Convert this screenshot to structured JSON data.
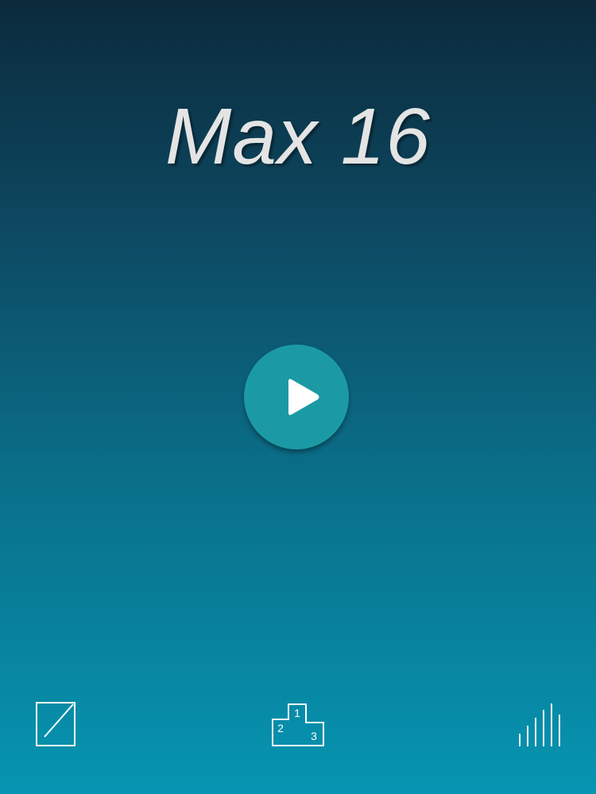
{
  "title": "Max 16",
  "play_button": {
    "icon": "play-icon"
  },
  "bottom_bar": {
    "edit": {
      "icon": "edit-icon"
    },
    "leaderboard": {
      "icon": "podium-icon",
      "places": [
        "1",
        "2",
        "3"
      ]
    },
    "stats": {
      "icon": "stats-bars-icon"
    }
  },
  "colors": {
    "background_top": "#0b2a3c",
    "background_bottom": "#0695b2",
    "title": "#e4e4e4",
    "play_button": "#1b9aa5",
    "icons": "#ffffff"
  }
}
